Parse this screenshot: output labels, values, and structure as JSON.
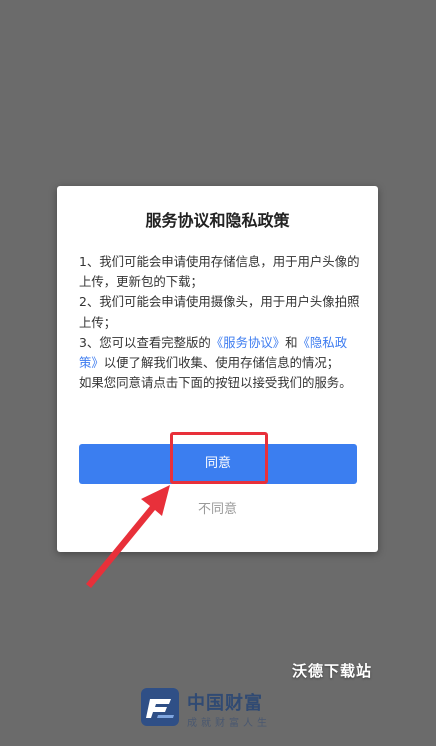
{
  "dialog": {
    "title": "服务协议和隐私政策",
    "p1": "1、我们可能会申请使用存储信息，用于用户头像的上传，更新包的下载；",
    "p2": "2、我们可能会申请使用摄像头，用于用户头像拍照上传；",
    "p3_prefix": "3、您可以查看完整版的",
    "link_service": "《服务协议》",
    "p3_and": "和",
    "link_privacy": "《隐私政策》",
    "p3_suffix": "以便了解我们收集、使用存储信息的情况；",
    "p4": "如果您同意请点击下面的按钮以接受我们的服务。",
    "agree_label": "同意",
    "disagree_label": "不同意"
  },
  "watermark": "沃德下载站",
  "brand": {
    "name": "中国财富",
    "slogan": "成就财富人生"
  },
  "colors": {
    "overlay": "#6b6b6b",
    "accent": "#3b7ef0",
    "link": "#3d7cf0",
    "annotation": "#e8303a",
    "brand": "#2f4f86"
  },
  "icons": {
    "annotation_arrow": "arrow-icon",
    "brand_logo": "logo-icon"
  }
}
